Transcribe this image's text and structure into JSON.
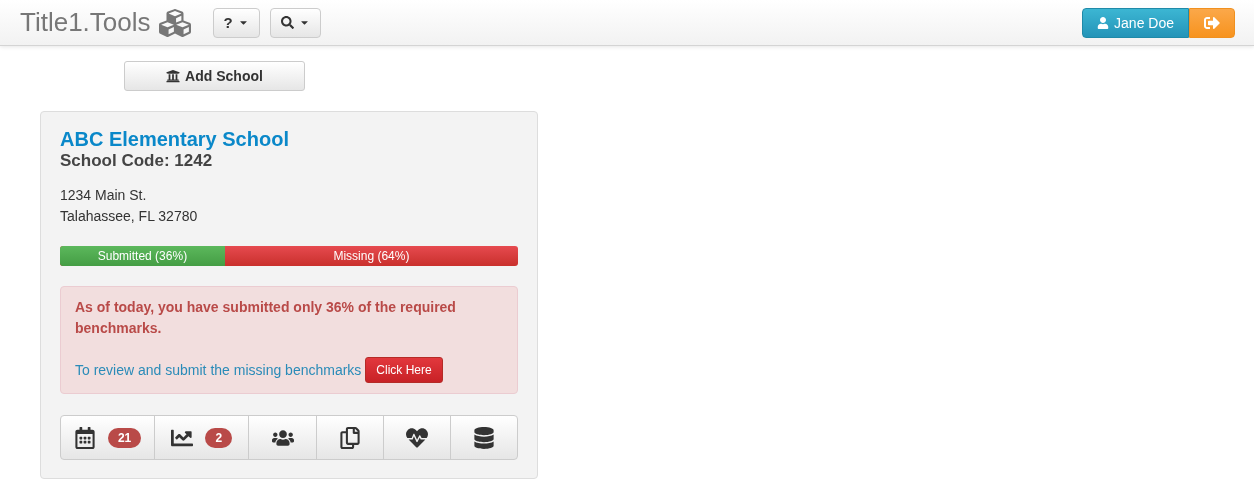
{
  "navbar": {
    "brand": "Title1.Tools",
    "menus": [
      {
        "kind": "help",
        "label": "?"
      },
      {
        "kind": "search"
      }
    ],
    "user": "Jane Doe"
  },
  "add_school_button": "Add School",
  "school": {
    "name": "ABC Elementary School",
    "code": "School Code: 1242",
    "address": [
      "1234 Main St.",
      "Talahassee, FL 32780"
    ],
    "progress": {
      "level": 0.36,
      "submitted_label": "Submitted (36%)",
      "missing_label": "Missing (64%)"
    },
    "alert": {
      "message": "As of today, you have submitted only 36% of the required benchmarks.",
      "prompt": "To review and submit the missing benchmarks",
      "button": "Click Here"
    },
    "tools": [
      {
        "kind": "calendar",
        "badge": "21"
      },
      {
        "kind": "chart",
        "badge": "2"
      },
      {
        "kind": "users"
      },
      {
        "kind": "copy"
      },
      {
        "kind": "heartbeat"
      },
      {
        "kind": "database"
      }
    ]
  }
}
